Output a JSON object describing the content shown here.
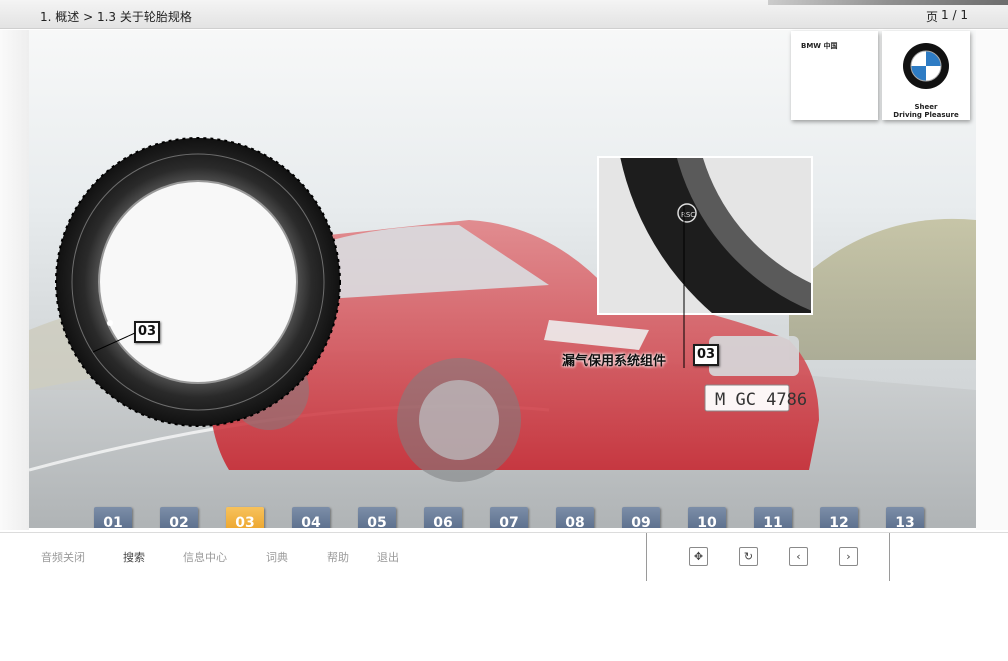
{
  "header": {
    "breadcrumb": "1. 概述 > 1.3 关于轮胎规格",
    "page_label": "页",
    "page_number": "1 / 1"
  },
  "brand": {
    "card_text": "BMW 中国",
    "tagline_1": "Sheer",
    "tagline_2": "Driving Pleasure"
  },
  "callouts": {
    "left_number": "03",
    "right_number": "03",
    "right_label": "漏气保用系统组件"
  },
  "nav": {
    "buttons": [
      "01",
      "02",
      "03",
      "04",
      "05",
      "06",
      "07",
      "08",
      "09",
      "10",
      "11",
      "12",
      "13"
    ],
    "active_index": 2
  },
  "footer": {
    "items": [
      "音频关闭",
      "搜索",
      "信息中心",
      "词典",
      "帮助",
      "退出"
    ],
    "controls": [
      "fit-icon",
      "refresh-icon",
      "prev-icon",
      "next-icon"
    ]
  },
  "colors": {
    "button_blue": "#5b6f8d",
    "button_active": "#ecaa2f",
    "car_red": "#c8202a"
  },
  "scene": {
    "license_plate": "M GC 4786"
  }
}
